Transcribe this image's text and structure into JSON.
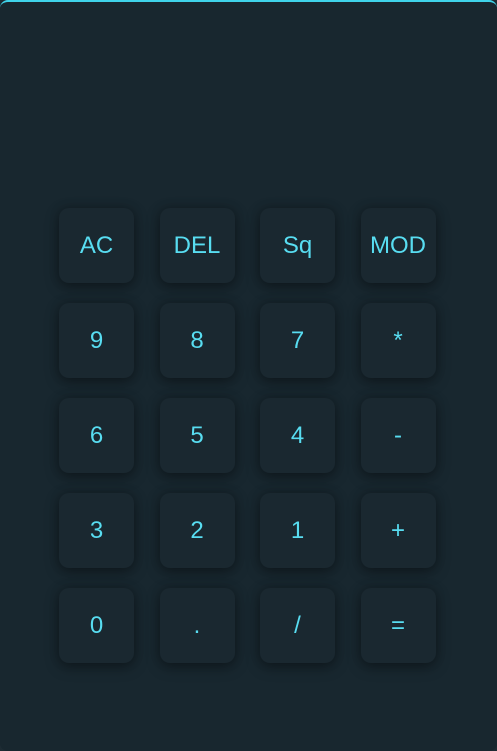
{
  "display": {
    "value": ""
  },
  "keypad": {
    "keys": [
      {
        "label": "AC"
      },
      {
        "label": "DEL"
      },
      {
        "label": "Sq"
      },
      {
        "label": "MOD"
      },
      {
        "label": "9"
      },
      {
        "label": "8"
      },
      {
        "label": "7"
      },
      {
        "label": "*"
      },
      {
        "label": "6"
      },
      {
        "label": "5"
      },
      {
        "label": "4"
      },
      {
        "label": "-"
      },
      {
        "label": "3"
      },
      {
        "label": "2"
      },
      {
        "label": "1"
      },
      {
        "label": "+"
      },
      {
        "label": "0"
      },
      {
        "label": "."
      },
      {
        "label": "/"
      },
      {
        "label": "="
      }
    ]
  },
  "colors": {
    "background": "#18272f",
    "accent": "#58ddf1",
    "top_border": "#3fd4ea"
  }
}
